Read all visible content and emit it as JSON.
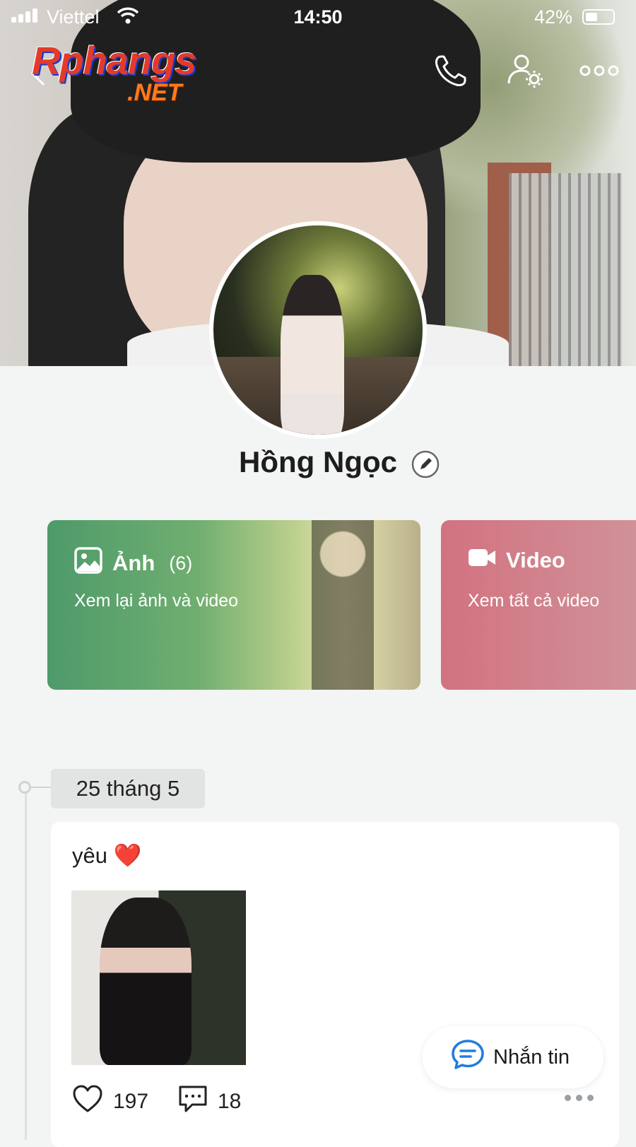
{
  "status_bar": {
    "carrier": "Viettel",
    "time": "14:50",
    "battery": "42%"
  },
  "watermark": {
    "line1": "Rphangs",
    "line2": ".NET"
  },
  "profile": {
    "name": "Hồng Ngọc"
  },
  "cards": {
    "photos": {
      "title": "Ảnh",
      "count": "(6)",
      "subtitle": "Xem lại ảnh và video"
    },
    "videos": {
      "title": "Video",
      "subtitle": "Xem tất cả video"
    }
  },
  "timeline": {
    "date": "25 tháng 5",
    "post": {
      "text": "yêu",
      "emoji": "❤️",
      "likes": "197",
      "comments": "18"
    }
  },
  "message_button": {
    "label": "Nhắn tin"
  },
  "icons": {
    "back": "back-chevron-icon",
    "call": "phone-icon",
    "settings": "user-settings-icon",
    "more": "more-dots-icon",
    "edit": "edit-pencil-icon",
    "photo": "image-icon",
    "video": "video-camera-icon",
    "like": "heart-icon",
    "comment": "comment-icon",
    "message": "chat-bubble-icon"
  },
  "colors": {
    "photo_card": "#4e9a6a",
    "video_card": "#d27280",
    "message_icon": "#1f7de0"
  }
}
